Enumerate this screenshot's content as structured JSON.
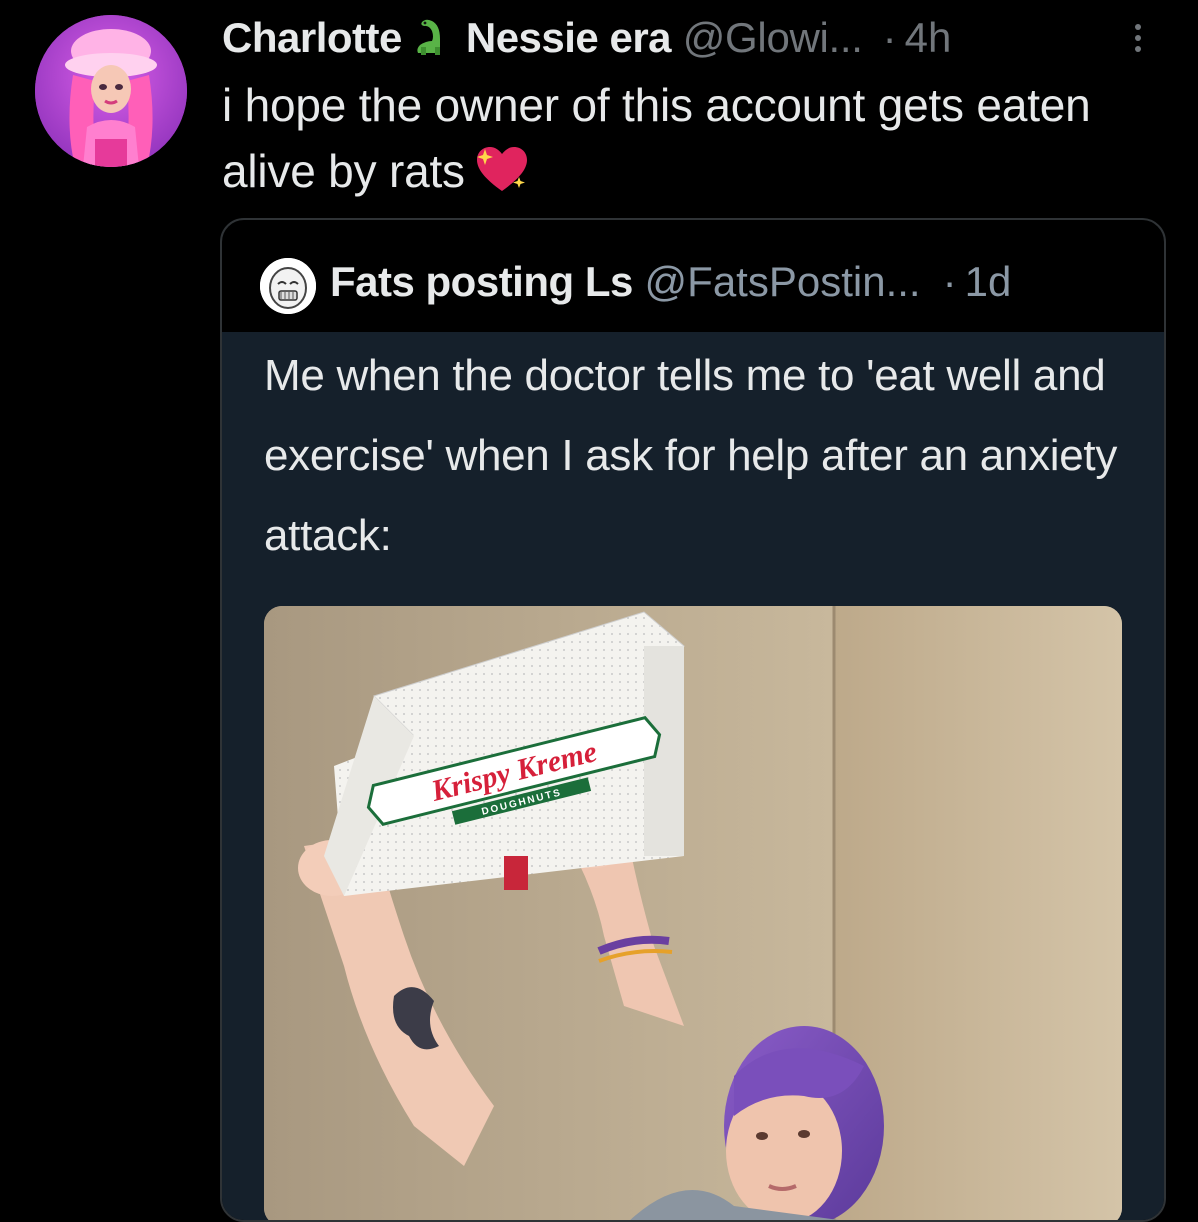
{
  "tweet": {
    "display_name": "Charlotte",
    "name_emoji": "sauropod-emoji",
    "name_suffix": "Nessie era",
    "handle": "@Glowi...",
    "separator": "·",
    "time": "4h",
    "text": "i hope the owner of this account gets eaten alive by rats",
    "text_emoji": "sparkling-heart-emoji"
  },
  "quoted_tweet": {
    "display_name": "Fats posting Ls",
    "handle": "@FatsPostin...",
    "separator": "·",
    "time": "1d",
    "text": "Me when the doctor tells me to 'eat well and exercise' when I ask for help after an anxiety attack:",
    "media": {
      "box_brand": "Krispy Kreme",
      "box_subtitle": "DOUGHNUTS"
    }
  },
  "colors": {
    "background": "#000000",
    "quote_background": "#15202b",
    "primary_text": "#e7e9ea",
    "secondary_text": "#71767b",
    "quote_border": "#2f3336",
    "heart": "#e0245e",
    "dino": "#59b347"
  },
  "icons": {
    "more": "more-vertical-icon"
  }
}
